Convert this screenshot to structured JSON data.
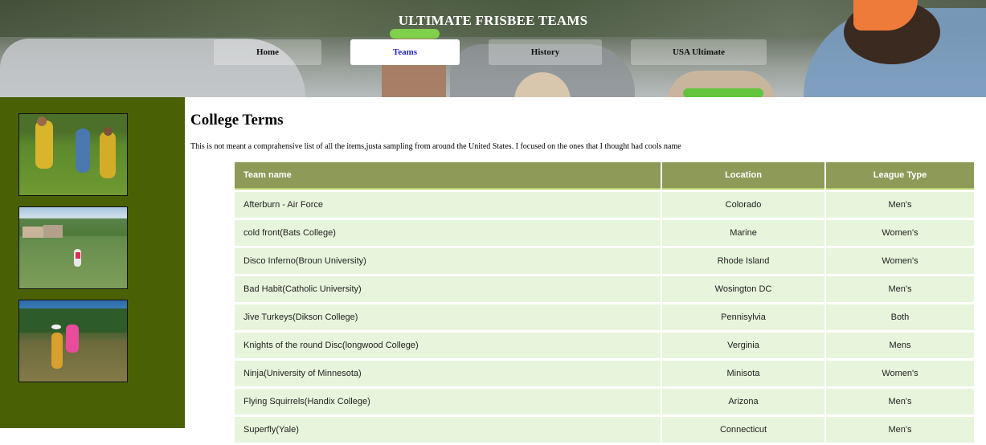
{
  "header": {
    "title": "ULTIMATE FRISBEE TEAMS",
    "nav": [
      {
        "label": "Home",
        "active": false
      },
      {
        "label": "Teams",
        "active": true
      },
      {
        "label": "History",
        "active": false
      },
      {
        "label": "USA Ultimate",
        "active": false
      }
    ]
  },
  "main": {
    "heading": "College Terms",
    "intro": "This is not meant a comprahensive list of all the items,justa sampling from around the United States. I focused on the ones that I thought had cools name",
    "table": {
      "headers": [
        "Team name",
        "Location",
        "League Type"
      ],
      "rows": [
        [
          "Afterburn - Air Force",
          "Colorado",
          "Men's"
        ],
        [
          "cold front(Bats College)",
          "Marine",
          "Women's"
        ],
        [
          "Disco Inferno(Broun University)",
          "Rhode Island",
          "Women's"
        ],
        [
          "Bad Habit(Catholic University)",
          "Wosington DC",
          "Men's"
        ],
        [
          "Jive Turkeys(Dikson College)",
          "Pennisylvia",
          "Both"
        ],
        [
          "Knights of the round Disc(longwood College)",
          "Verginia",
          "Mens"
        ],
        [
          "Ninja(University of Minnesota)",
          "Minisota",
          "Women's"
        ],
        [
          "Flying Squirrels(Handix College)",
          "Arizona",
          "Men's"
        ],
        [
          "Superfly(Yale)",
          "Connecticut",
          "Men's"
        ]
      ]
    }
  },
  "colors": {
    "sidebar": "#496104",
    "table_header": "#8d9a58",
    "table_row": "#e7f5dc",
    "active_nav_text": "#2323c8"
  }
}
